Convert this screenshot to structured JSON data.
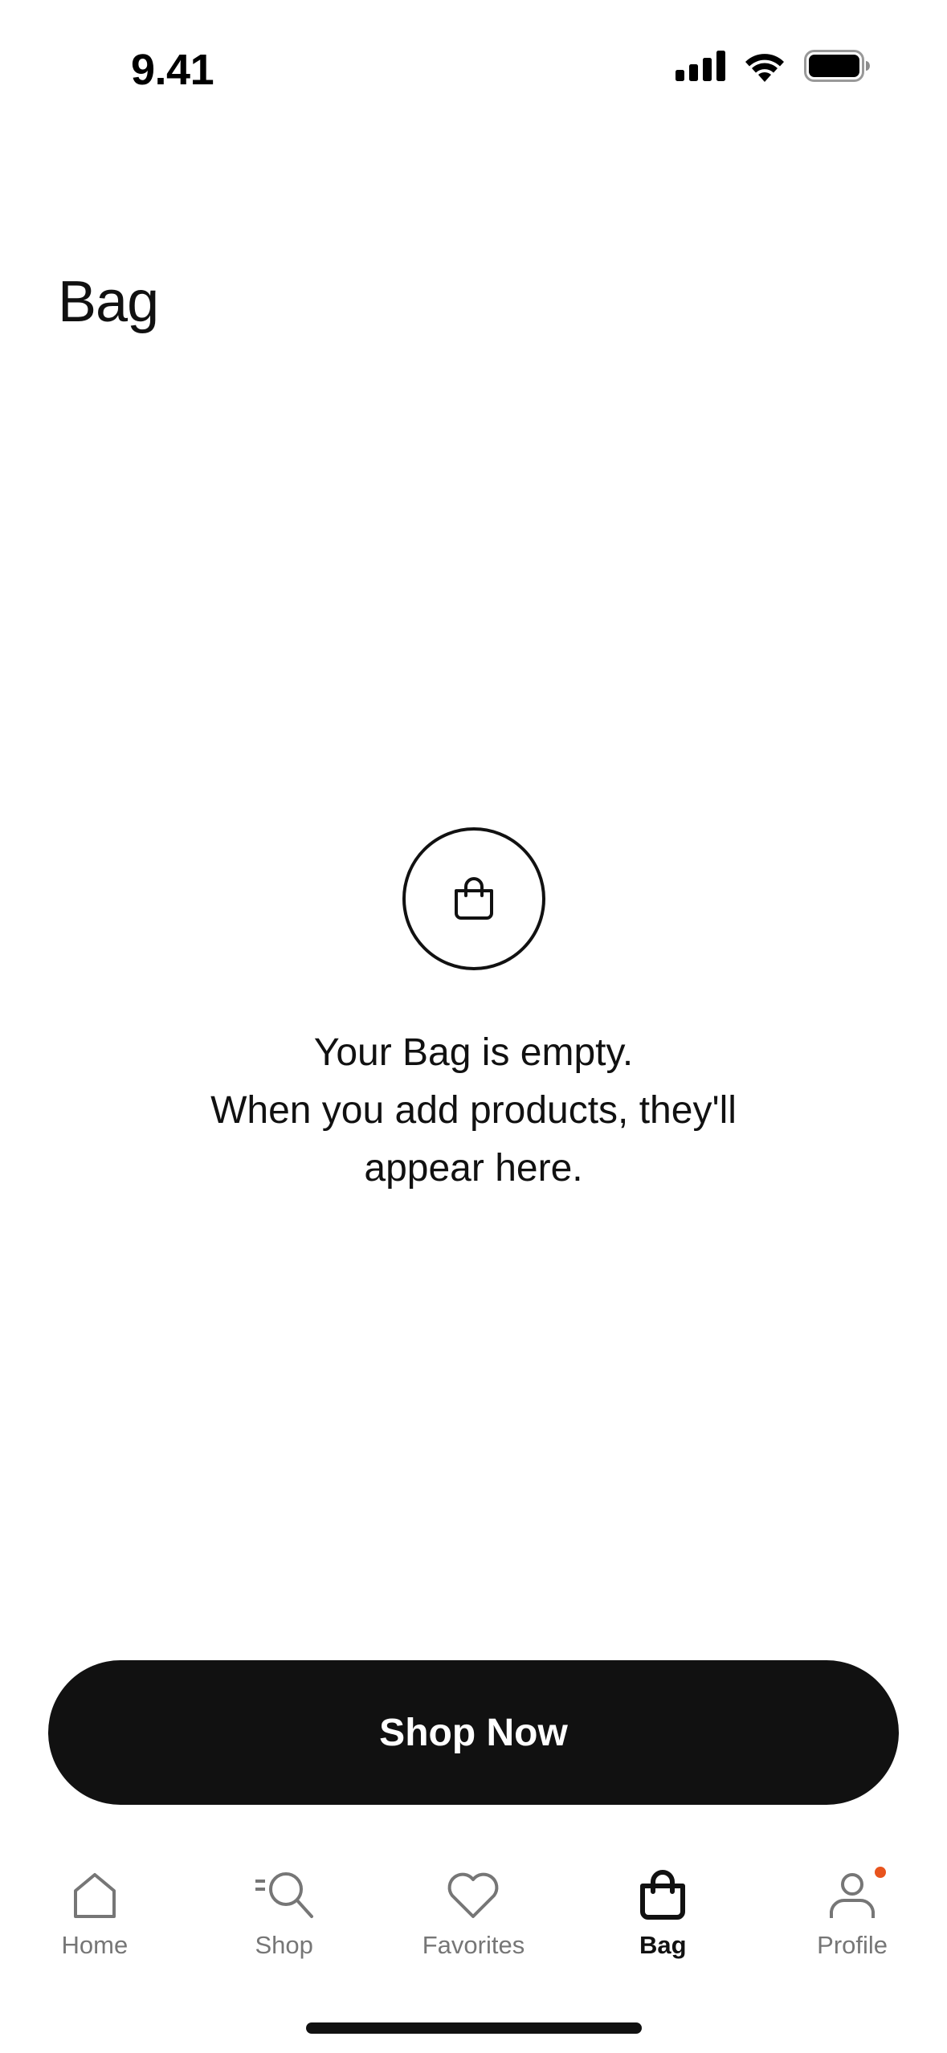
{
  "status_bar": {
    "time": "9.41"
  },
  "page": {
    "title": "Bag"
  },
  "empty_state": {
    "icon": "shopping-bag-icon",
    "line1": "Your Bag is empty.",
    "line2": "When you add products, they'll",
    "line3": "appear here."
  },
  "actions": {
    "shop_now_label": "Shop Now"
  },
  "tab_bar": {
    "active": "Bag",
    "items": [
      {
        "label": "Home",
        "icon": "home-icon"
      },
      {
        "label": "Shop",
        "icon": "search-icon"
      },
      {
        "label": "Favorites",
        "icon": "heart-icon"
      },
      {
        "label": "Bag",
        "icon": "bag-icon"
      },
      {
        "label": "Profile",
        "icon": "profile-icon"
      }
    ]
  },
  "colors": {
    "primary": "#111111",
    "inactive": "#767676",
    "notification": "#e8541d",
    "background": "#ffffff"
  }
}
